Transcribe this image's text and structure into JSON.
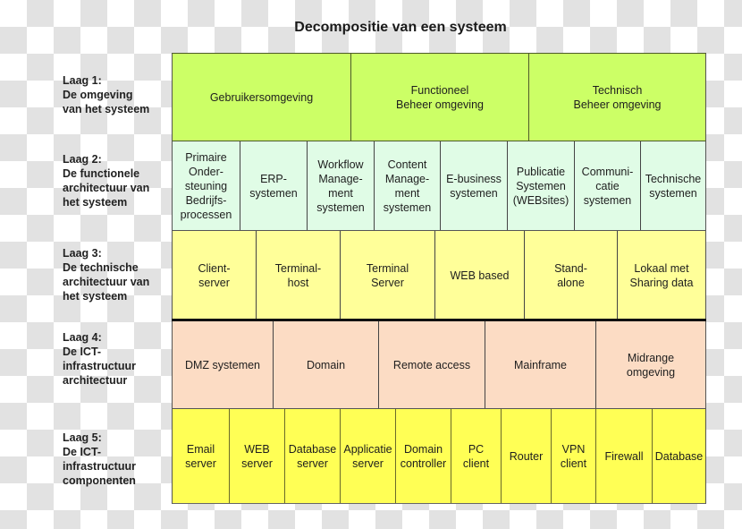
{
  "title": "Decompositie van een systeem",
  "colors": {
    "layer1": "#ccff66",
    "layer2": "#e0fce6",
    "layer3": "#ffff99",
    "layer4": "#fcdcc4",
    "layer5": "#ffff55"
  },
  "layers": [
    {
      "label": "Laag 1:\nDe omgeving\nvan het systeem",
      "cells": [
        "Gebruikersomgeving",
        "Functioneel\nBeheer omgeving",
        "Technisch\nBeheer omgeving"
      ]
    },
    {
      "label": "Laag 2:\nDe functionele\narchitectuur van\nhet systeem",
      "cells": [
        "Primaire\nOnder-\nsteuning\nBedrijfs-\nprocessen",
        "ERP-\nsystemen",
        "Workflow\nManage-\nment\nsystemen",
        "Content\nManage-\nment\nsystemen",
        "E-business\nsystemen",
        "Publicatie\nSystemen\n(WEBsites)",
        "Communi-\ncatie\nsystemen",
        "Technische\nsystemen"
      ]
    },
    {
      "label": "Laag 3:\nDe technische\narchitectuur van\nhet systeem",
      "cells": [
        "Client-\nserver",
        "Terminal-\nhost",
        "Terminal\nServer",
        "WEB based",
        "Stand-\nalone",
        "Lokaal met\nSharing data"
      ]
    },
    {
      "label": "Laag 4:\nDe ICT-\ninfrastructuur\narchitectuur",
      "cells": [
        "DMZ systemen",
        "Domain",
        "Remote access",
        "Mainframe",
        "Midrange\nomgeving"
      ]
    },
    {
      "label": "Laag 5:\nDe ICT-\ninfrastructuur\ncomponenten",
      "cells": [
        "Email\nserver",
        "WEB\nserver",
        "Database\nserver",
        "Applicatie\nserver",
        "Domain\ncontroller",
        "PC\nclient",
        "Router",
        "VPN\nclient",
        "Firewall",
        "Database"
      ]
    }
  ]
}
